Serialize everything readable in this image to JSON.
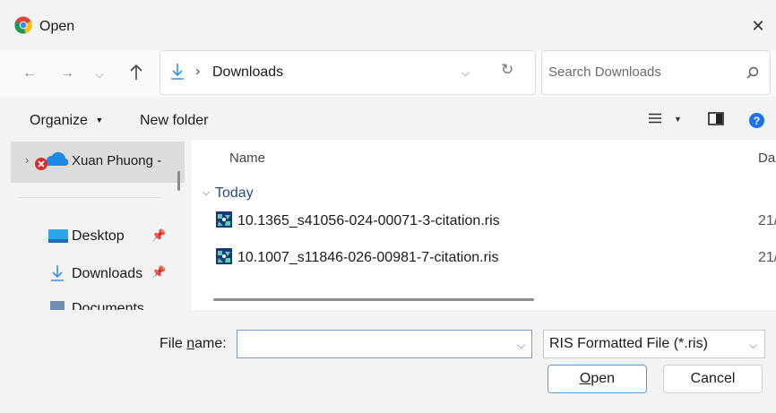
{
  "window": {
    "title": "Open",
    "close_icon": "close-icon",
    "app_icon": "chrome-icon"
  },
  "navigation": {
    "back_icon": "back-arrow-icon",
    "forward_icon": "forward-arrow-icon",
    "recent_icon": "chevron-down-icon",
    "up_icon": "up-arrow-icon",
    "address": {
      "folder_icon": "download-arrow-icon",
      "separator": "›",
      "location": "Downloads"
    },
    "search": {
      "placeholder": "Search Downloads",
      "icon": "search-icon"
    }
  },
  "toolbar": {
    "organize": "Organize",
    "new_folder": "New folder"
  },
  "sidebar": {
    "items": [
      {
        "label": "Xuan Phuong -",
        "icon": "onedrive-error-icon",
        "selected": true
      },
      {
        "label": "Desktop",
        "icon": "desktop-icon",
        "pinned": true
      },
      {
        "label": "Downloads",
        "icon": "download-arrow-icon",
        "pinned": true
      },
      {
        "label": "Documents",
        "icon": "documents-icon",
        "pinned": true
      }
    ]
  },
  "file_list": {
    "columns": [
      "Name",
      "Da"
    ],
    "groups": [
      {
        "label": "Today",
        "files": [
          {
            "name": "10.1365_s41056-024-00071-3-citation.ris",
            "date": "21/",
            "icon": "ris-file-icon"
          },
          {
            "name": "10.1007_s11846-026-00981-7-citation.ris",
            "date": "21/",
            "icon": "ris-file-icon"
          }
        ]
      }
    ]
  },
  "footer": {
    "file_name_label_prefix": "File ",
    "file_name_label_access": "n",
    "file_name_label_suffix": "ame:",
    "file_name_value": "",
    "file_type": "RIS Formatted File (*.ris)",
    "open_access": "O",
    "open_rest": "pen",
    "cancel": "Cancel"
  }
}
